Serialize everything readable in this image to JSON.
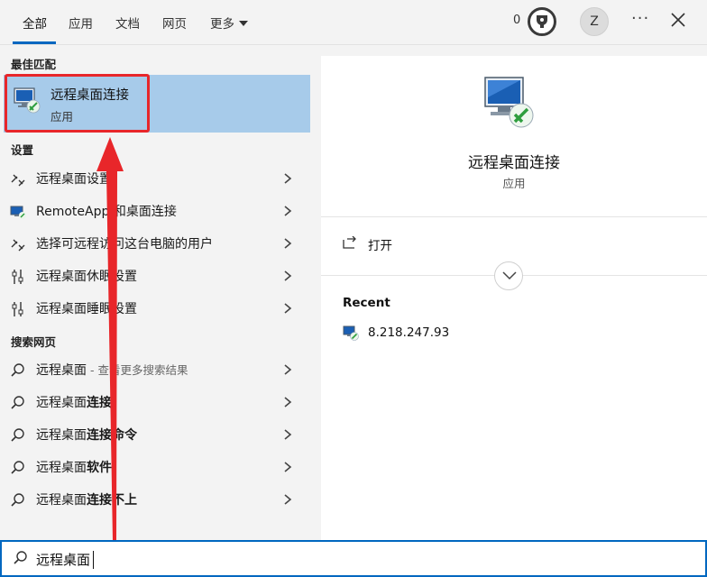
{
  "tabs": [
    {
      "label": "全部",
      "active": true
    },
    {
      "label": "应用"
    },
    {
      "label": "文档"
    },
    {
      "label": "网页"
    },
    {
      "label": "更多"
    }
  ],
  "header": {
    "reward_points": "0",
    "avatar_initial": "Z",
    "more_label": "···"
  },
  "best_match": {
    "section": "最佳匹配",
    "name": "远程桌面连接",
    "type": "应用"
  },
  "settings": {
    "section": "设置",
    "items": [
      {
        "label": "远程桌面设置",
        "icon": "remote-link-icon"
      },
      {
        "label": "RemoteApp 和桌面连接",
        "icon": "monitor-icon"
      },
      {
        "label": "选择可远程访问这台电脑的用户",
        "icon": "remote-link-icon"
      },
      {
        "label": "远程桌面休眠设置",
        "icon": "sliders-icon"
      },
      {
        "label": "远程桌面睡眠设置",
        "icon": "sliders-icon"
      }
    ]
  },
  "web": {
    "section": "搜索网页",
    "items": [
      {
        "prefix": "远程桌面",
        "bold": "",
        "hint": " - 查看更多搜索结果"
      },
      {
        "prefix": "远程桌面",
        "bold": "连接",
        "hint": ""
      },
      {
        "prefix": "远程桌面",
        "bold": "连接命令",
        "hint": ""
      },
      {
        "prefix": "远程桌面",
        "bold": "软件",
        "hint": ""
      },
      {
        "prefix": "远程桌面",
        "bold": "连接不上",
        "hint": ""
      }
    ]
  },
  "details": {
    "title": "远程桌面连接",
    "type": "应用",
    "open_label": "打开",
    "recent_title": "Recent",
    "recent_items": [
      "8.218.247.93"
    ]
  },
  "search": {
    "value": "远程桌面"
  },
  "colors": {
    "accent": "#0067c0",
    "selected": "#a7cbea",
    "annotation": "#e8262a"
  }
}
